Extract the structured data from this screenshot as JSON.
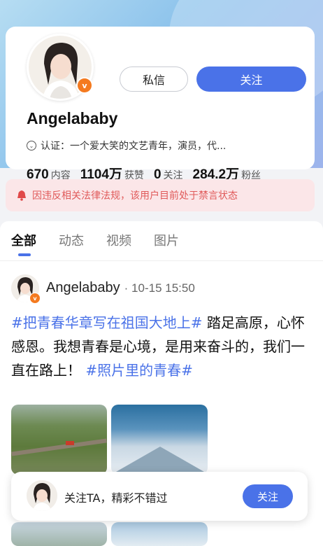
{
  "profile": {
    "name": "Angelababy",
    "verified_badge": "v",
    "verification_text": "认证：一个爱大笑的文艺青年，演员，代...",
    "buttons": {
      "message": "私信",
      "follow": "关注"
    },
    "stats": [
      {
        "value": "670",
        "label": "内容"
      },
      {
        "value": "1104万",
        "label": "获赞"
      },
      {
        "value": "0",
        "label": "关注"
      },
      {
        "value": "284.2万",
        "label": "粉丝"
      }
    ]
  },
  "notice": {
    "text": "因违反相关法律法规，该用户目前处于禁言状态",
    "icon": "bell-icon",
    "color": "#e05a5a"
  },
  "tabs": [
    {
      "label": "全部",
      "active": true
    },
    {
      "label": "动态",
      "active": false
    },
    {
      "label": "视频",
      "active": false
    },
    {
      "label": "图片",
      "active": false
    }
  ],
  "post": {
    "user": "Angelababy",
    "time": "· 10-15 15:50",
    "tag1": "#把青春华章写在祖国大地上#",
    "body": " 踏足高原，心怀感恩。我想青春是心境，是用来奋斗的，我们一直在路上！ ",
    "tag2": "#照片里的青春#"
  },
  "float_bar": {
    "text": "关注TA，精彩不错过",
    "button": "关注"
  },
  "colors": {
    "accent": "#4a72e8",
    "badge": "#f47a1f",
    "notice_bg": "#fbe6e8"
  }
}
